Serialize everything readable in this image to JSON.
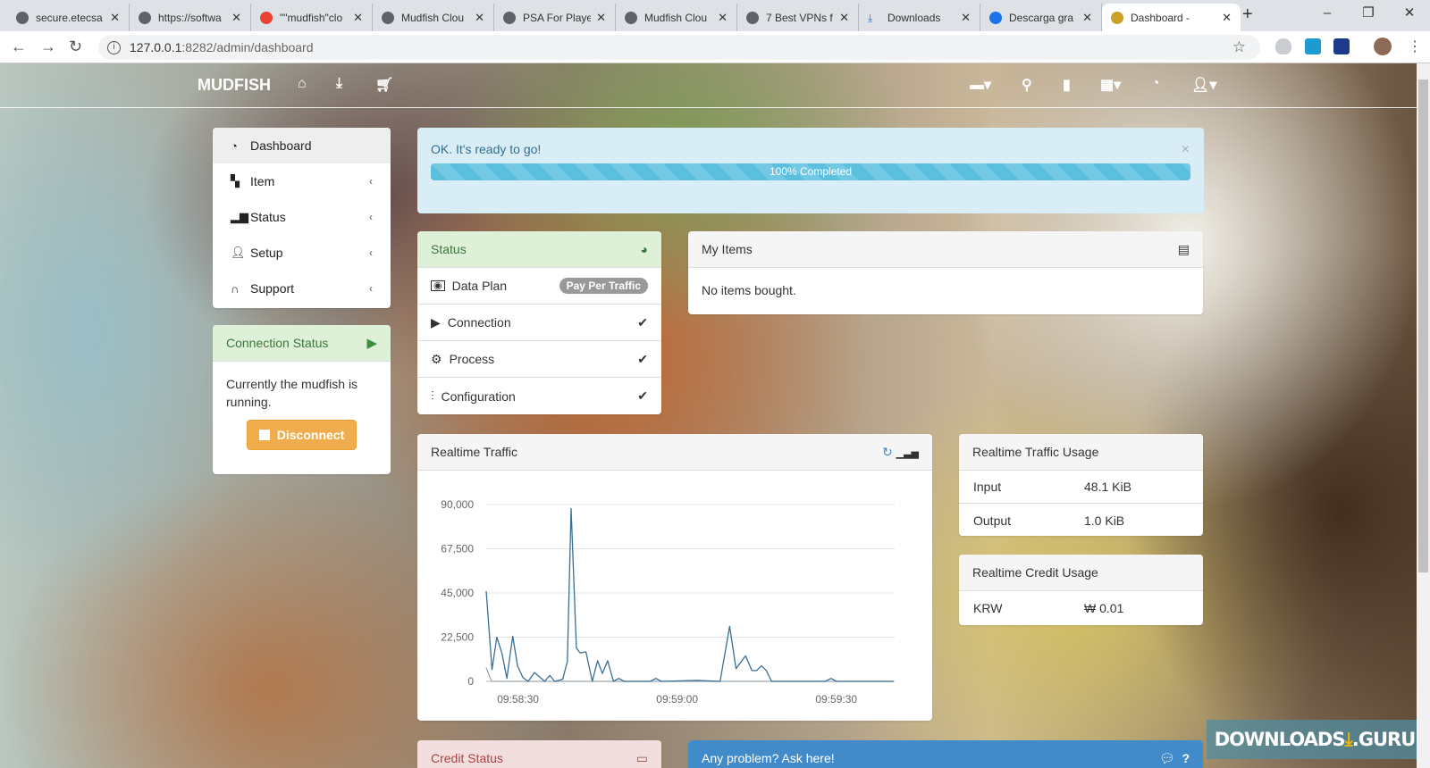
{
  "browser": {
    "tabs": [
      {
        "title": "secure.etecsa",
        "icon": "globe-icon"
      },
      {
        "title": "https://softwa",
        "icon": "site-icon"
      },
      {
        "title": "\"\"mudfish\"clo",
        "icon": "google-icon"
      },
      {
        "title": "Mudfish Clou",
        "icon": "site-icon"
      },
      {
        "title": "PSA For Playe",
        "icon": "globe-icon"
      },
      {
        "title": "Mudfish Clou",
        "icon": "globe-icon"
      },
      {
        "title": "7 Best VPNs f",
        "icon": "globe-icon"
      },
      {
        "title": "Downloads",
        "icon": "download-icon"
      },
      {
        "title": "Descarga gra",
        "icon": "shield-icon"
      },
      {
        "title": "Dashboard - ",
        "icon": "mudfish-icon"
      }
    ],
    "url_host": "127.0.0.1",
    "url_rest": ":8282/admin/dashboard"
  },
  "navbar": {
    "brand": "MUDFISH"
  },
  "sidebar": {
    "items": [
      {
        "label": "Dashboard",
        "icon": "dashboard-icon"
      },
      {
        "label": "Item",
        "icon": "gift-icon"
      },
      {
        "label": "Status",
        "icon": "bar-chart-icon"
      },
      {
        "label": "Setup",
        "icon": "user-icon"
      },
      {
        "label": "Support",
        "icon": "headphones-icon"
      }
    ]
  },
  "connection_status": {
    "title": "Connection Status",
    "message": "Currently the mudfish is running.",
    "button": "Disconnect"
  },
  "alert": {
    "message": "OK. It's ready to go!",
    "progress_label": "100% Completed",
    "progress": 100
  },
  "status_panel": {
    "title": "Status",
    "items": [
      {
        "label": "Data Plan",
        "badge": "Pay Per Traffic"
      },
      {
        "label": "Connection"
      },
      {
        "label": "Process"
      },
      {
        "label": "Configuration"
      }
    ]
  },
  "my_items": {
    "title": "My Items",
    "message": "No items bought."
  },
  "traffic": {
    "title": "Realtime Traffic"
  },
  "traffic_usage": {
    "title": "Realtime Traffic Usage",
    "rows": [
      {
        "label": "Input",
        "value": "48.1 KiB"
      },
      {
        "label": "Output",
        "value": "1.0 KiB"
      }
    ]
  },
  "credit_usage": {
    "title": "Realtime Credit Usage",
    "rows": [
      {
        "label": "KRW",
        "value": "₩ 0.01"
      }
    ]
  },
  "credit_status": {
    "title": "Credit Status"
  },
  "ask": {
    "title": "Any problem? Ask here!"
  },
  "watermark": "DOWNLOADS .GURU",
  "chart_data": {
    "type": "line",
    "title": "Realtime Traffic",
    "x_unit": "seconds after 09:58:00",
    "xlim": [
      24,
      101
    ],
    "ylim": [
      0,
      90000
    ],
    "yticks": [
      0,
      22500,
      45000,
      67500,
      90000
    ],
    "ytick_labels": [
      "0",
      "22,500",
      "45,000",
      "67,500",
      "90,000"
    ],
    "xticks": [
      30,
      60,
      90
    ],
    "xtick_labels": [
      "09:58:30",
      "09:59:00",
      "09:59:30"
    ],
    "grid": true,
    "series": [
      {
        "name": "input",
        "color": "#3a6f96",
        "points": [
          [
            24,
            46000
          ],
          [
            25.1,
            6000
          ],
          [
            26,
            22500
          ],
          [
            27,
            14000
          ],
          [
            27.9,
            1500
          ],
          [
            29,
            23000
          ],
          [
            29.9,
            8000
          ],
          [
            30.9,
            2000
          ],
          [
            31.9,
            0
          ],
          [
            33.1,
            4500
          ],
          [
            34.2,
            2000
          ],
          [
            35,
            0
          ],
          [
            36,
            3000
          ],
          [
            36.9,
            0
          ],
          [
            38.4,
            1000
          ],
          [
            39.3,
            10000
          ],
          [
            40,
            88000
          ],
          [
            41,
            17000
          ],
          [
            41.7,
            14500
          ],
          [
            42.8,
            15000
          ],
          [
            44,
            0
          ],
          [
            45,
            10500
          ],
          [
            45.9,
            4000
          ],
          [
            46.9,
            10500
          ],
          [
            48,
            0
          ],
          [
            49,
            1500
          ],
          [
            50,
            0
          ],
          [
            54.9,
            0
          ],
          [
            56,
            1500
          ],
          [
            57,
            0
          ],
          [
            63.9,
            500
          ],
          [
            68.1,
            0
          ],
          [
            69.9,
            28000
          ],
          [
            71.1,
            6500
          ],
          [
            72.9,
            13000
          ],
          [
            74.1,
            5500
          ],
          [
            75,
            5500
          ],
          [
            75.9,
            8000
          ],
          [
            76.8,
            5500
          ],
          [
            77.8,
            0
          ],
          [
            87.9,
            0
          ],
          [
            89,
            1500
          ],
          [
            90,
            0
          ],
          [
            100.8,
            0
          ]
        ]
      },
      {
        "name": "output",
        "color": "#9aa8b2",
        "points": [
          [
            24,
            7000
          ],
          [
            25,
            0
          ],
          [
            100.8,
            0
          ]
        ]
      }
    ]
  }
}
